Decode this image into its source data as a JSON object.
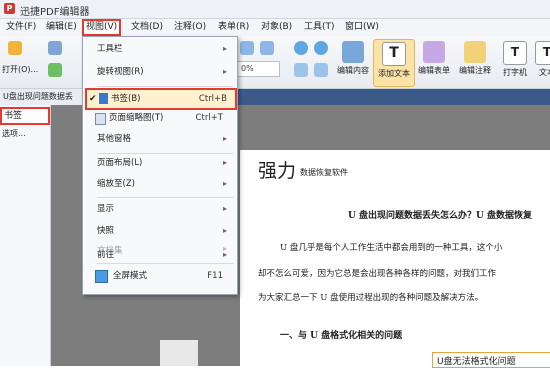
{
  "app": {
    "title": "迅捷PDF编辑器",
    "logo_letter": "P"
  },
  "menubar": {
    "items": [
      {
        "label": "文件(F)"
      },
      {
        "label": "编辑(E)"
      },
      {
        "label": "视图(V)"
      },
      {
        "label": "文档(D)"
      },
      {
        "label": "注释(O)"
      },
      {
        "label": "表单(R)"
      },
      {
        "label": "对象(B)"
      },
      {
        "label": "工具(T)"
      },
      {
        "label": "窗口(W)"
      }
    ]
  },
  "toolbar": {
    "open_label": "打开(O)...",
    "zoom_value": "0%",
    "buttons": [
      {
        "label": "编辑内容"
      },
      {
        "label": "添加文本"
      },
      {
        "label": "编辑表单"
      },
      {
        "label": "编辑注释"
      },
      {
        "label": "打字机"
      },
      {
        "label": "文本"
      }
    ]
  },
  "tabbar": {
    "doc_tab": "U盘出现问题数据丢"
  },
  "left_panel": {
    "title": "书签",
    "options": "选项..."
  },
  "view_menu": {
    "items": [
      {
        "label": "工具栏",
        "submenu": true
      },
      {
        "label": "旋转视图(R)",
        "submenu": true
      },
      {
        "label": "书签(B)",
        "shortcut": "Ctrl+B",
        "checked": true
      },
      {
        "label": "页面缩略图(T)",
        "shortcut": "Ctrl+T"
      },
      {
        "label": "其他窗格",
        "submenu": true
      },
      {
        "label": "页面布局(L)",
        "submenu": true
      },
      {
        "label": "缩放至(Z)",
        "submenu": true
      },
      {
        "label": "显示",
        "submenu": true
      },
      {
        "label": "快照",
        "submenu": true
      },
      {
        "label": "前往",
        "submenu": true
      },
      {
        "label": "文档集",
        "submenu": true,
        "disabled": true
      },
      {
        "label": "全屏模式",
        "shortcut": "F11"
      }
    ],
    "check_mark": "✔",
    "arrow": "▸"
  },
  "document": {
    "brand_big": "强力",
    "brand_small": "数据恢复软件",
    "heading": "U 盘出现问题数据丢失怎么办？U 盘数据恢复",
    "para1": "U 盘几乎是每个人工作生活中都会用到的一种工具，这个小",
    "para2": "却不怎么可爱，因为它总是会出现各种各样的问题，对我们工作",
    "para3": "为大家汇总一下 U 盘使用过程出现的各种问题及解决方法。",
    "section": "一、与 U 盘格式化相关的问题",
    "annotation": "U盘无法格式化问题"
  },
  "colors": {
    "highlight": "#e53935",
    "tabbar": "#3c5a88"
  }
}
